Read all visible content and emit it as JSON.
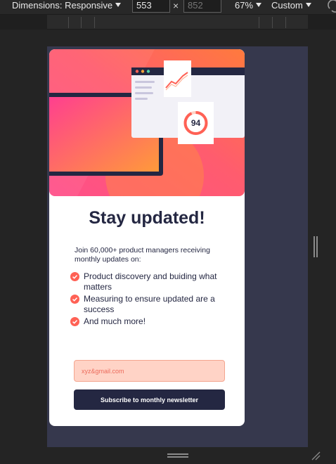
{
  "devtools": {
    "dimensions_label": "Dimensions: Responsive",
    "width_value": "553",
    "height_placeholder": "852",
    "times": "×",
    "zoom_label": "67%",
    "throttle_label": "Custom"
  },
  "card": {
    "hero": {
      "score": "94"
    },
    "title": "Stay updated!",
    "intro": "Join 60,000+ product managers receiving monthly updates on:",
    "list": [
      "Product discovery and buiding what matters",
      "Measuring to ensure updated are a success",
      "And much more!"
    ],
    "email_placeholder": "xyz&gmail.com",
    "subscribe_label": "Subscribe to monthly newsletter"
  },
  "colors": {
    "dark_navy": "#242742",
    "tomato": "#ff6155",
    "email_bg": "#ffd3c6",
    "viewport_bg": "#36384d"
  }
}
